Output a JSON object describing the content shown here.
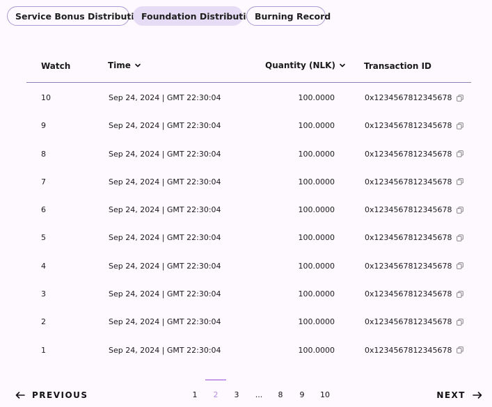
{
  "tabs": [
    {
      "label": "Service Bonus Distribution",
      "active": false
    },
    {
      "label": "Foundation Distribution",
      "active": true
    },
    {
      "label": "Burning Record",
      "active": false
    }
  ],
  "table": {
    "headers": {
      "watch": "Watch",
      "time": "Time",
      "quantity": "Quantity (NLK)",
      "transaction_id": "Transaction ID"
    },
    "rows": [
      {
        "watch": "10",
        "time": "Sep 24, 2024 | GMT 22:30:04",
        "quantity": "100.0000",
        "tx": "0x1234567812345678"
      },
      {
        "watch": "9",
        "time": "Sep 24, 2024 | GMT 22:30:04",
        "quantity": "100.0000",
        "tx": "0x1234567812345678"
      },
      {
        "watch": "8",
        "time": "Sep 24, 2024 | GMT 22:30:04",
        "quantity": "100.0000",
        "tx": "0x1234567812345678"
      },
      {
        "watch": "7",
        "time": "Sep 24, 2024 | GMT 22:30:04",
        "quantity": "100.0000",
        "tx": "0x1234567812345678"
      },
      {
        "watch": "6",
        "time": "Sep 24, 2024 | GMT 22:30:04",
        "quantity": "100.0000",
        "tx": "0x1234567812345678"
      },
      {
        "watch": "5",
        "time": "Sep 24, 2024 | GMT 22:30:04",
        "quantity": "100.0000",
        "tx": "0x1234567812345678"
      },
      {
        "watch": "4",
        "time": "Sep 24, 2024 | GMT 22:30:04",
        "quantity": "100.0000",
        "tx": "0x1234567812345678"
      },
      {
        "watch": "3",
        "time": "Sep 24, 2024 | GMT 22:30:04",
        "quantity": "100.0000",
        "tx": "0x1234567812345678"
      },
      {
        "watch": "2",
        "time": "Sep 24, 2024 | GMT 22:30:04",
        "quantity": "100.0000",
        "tx": "0x1234567812345678"
      },
      {
        "watch": "1",
        "time": "Sep 24, 2024 | GMT 22:30:04",
        "quantity": "100.0000",
        "tx": "0x1234567812345678"
      }
    ]
  },
  "pagination": {
    "previous_label": "PREVIOUS",
    "next_label": "NEXT",
    "pages": [
      "1",
      "2",
      "3",
      "...",
      "8",
      "9",
      "10"
    ],
    "current_page": "2"
  },
  "colors": {
    "background": "#fdf9fe",
    "active_tab": "#e6dcf5",
    "accent": "#b78ee6",
    "divider": "#8a7fb5"
  },
  "icons": {
    "sort": "chevron-down-icon",
    "copy": "copy-icon",
    "previous": "arrow-left-icon",
    "next": "arrow-right-icon"
  }
}
